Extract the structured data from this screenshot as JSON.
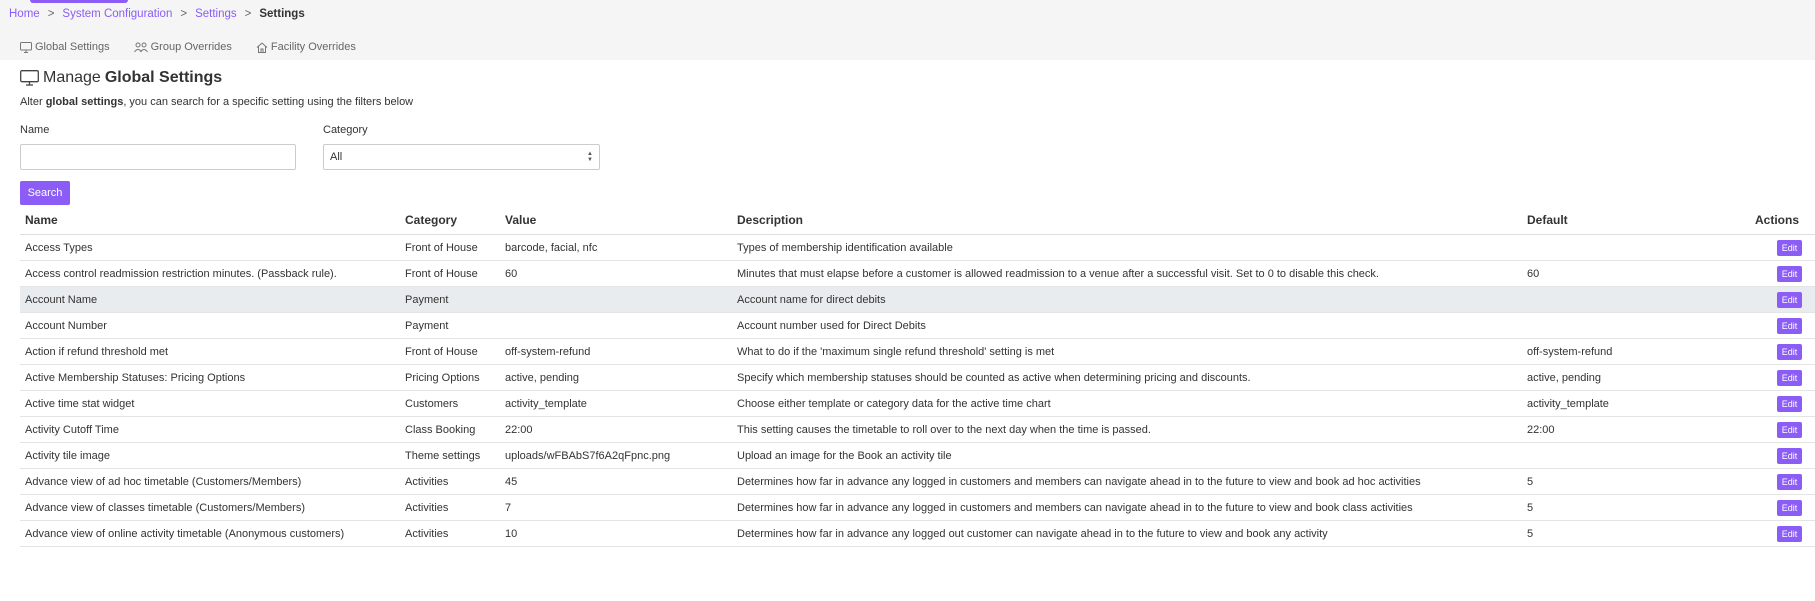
{
  "breadcrumb": {
    "items": [
      "Home",
      "System Configuration",
      "Settings"
    ],
    "current": "Settings",
    "separator": ">"
  },
  "tabs": [
    {
      "label": "Global Settings",
      "icon": "monitor-icon"
    },
    {
      "label": "Group Overrides",
      "icon": "users-icon"
    },
    {
      "label": "Facility Overrides",
      "icon": "home-icon"
    }
  ],
  "page": {
    "title_prefix": "Manage",
    "title_bold": "Global Settings",
    "subtitle_prefix": "Alter",
    "subtitle_bold": "global settings",
    "subtitle_suffix": ", you can search for a specific setting using the filters below"
  },
  "filters": {
    "name_label": "Name",
    "name_value": "",
    "category_label": "Category",
    "category_value": "All",
    "search_label": "Search"
  },
  "table": {
    "headers": {
      "name": "Name",
      "category": "Category",
      "value": "Value",
      "description": "Description",
      "default": "Default",
      "actions": "Actions"
    },
    "edit_label": "Edit",
    "rows": [
      {
        "name": "Access Types",
        "category": "Front of House",
        "value": "barcode, facial, nfc",
        "description": "Types of membership identification available",
        "default": ""
      },
      {
        "name": "Access control readmission restriction minutes. (Passback rule).",
        "category": "Front of House",
        "value": "60",
        "description": "Minutes that must elapse before a customer is allowed readmission to a venue after a successful visit. Set to 0 to disable this check.",
        "default": "60"
      },
      {
        "name": "Account Name",
        "category": "Payment",
        "value": "",
        "description": "Account name for direct debits",
        "default": ""
      },
      {
        "name": "Account Number",
        "category": "Payment",
        "value": "",
        "description": "Account number used for Direct Debits",
        "default": ""
      },
      {
        "name": "Action if refund threshold met",
        "category": "Front of House",
        "value": "off-system-refund",
        "description": "What to do if the 'maximum single refund threshold' setting is met",
        "default": "off-system-refund"
      },
      {
        "name": "Active Membership Statuses: Pricing Options",
        "category": "Pricing Options",
        "value": "active, pending",
        "description": "Specify which membership statuses should be counted as active when determining pricing and discounts.",
        "default": "active, pending"
      },
      {
        "name": "Active time stat widget",
        "category": "Customers",
        "value": "activity_template",
        "description": "Choose either template or category data for the active time chart",
        "default": "activity_template"
      },
      {
        "name": "Activity Cutoff Time",
        "category": "Class Booking",
        "value": "22:00",
        "description": "This setting causes the timetable to roll over to the next day when the time is passed.",
        "default": "22:00"
      },
      {
        "name": "Activity tile image",
        "category": "Theme settings",
        "value": "uploads/wFBAbS7f6A2qFpnc.png",
        "description": "Upload an image for the Book an activity tile",
        "default": ""
      },
      {
        "name": "Advance view of ad hoc timetable (Customers/Members)",
        "category": "Activities",
        "value": "45",
        "description": "Determines how far in advance any logged in customers and members can navigate ahead in to the future to view and book ad hoc activities",
        "default": "5"
      },
      {
        "name": "Advance view of classes timetable (Customers/Members)",
        "category": "Activities",
        "value": "7",
        "description": "Determines how far in advance any logged in customers and members can navigate ahead in to the future to view and book class activities",
        "default": "5"
      },
      {
        "name": "Advance view of online activity timetable (Anonymous customers)",
        "category": "Activities",
        "value": "10",
        "description": "Determines how far in advance any logged out customer can navigate ahead in to the future to view and book any activity",
        "default": "5"
      }
    ]
  },
  "colors": {
    "accent": "#8b5cf6",
    "highlight_row": "#e9ecef"
  }
}
